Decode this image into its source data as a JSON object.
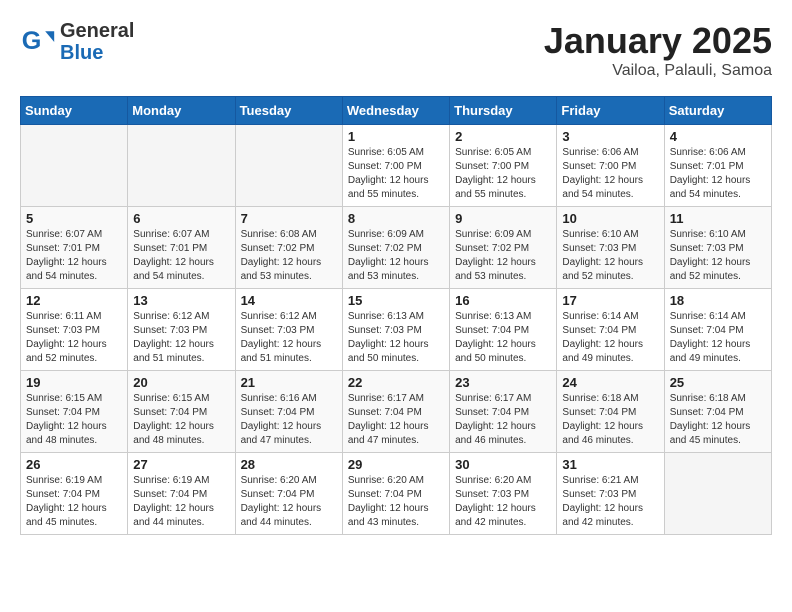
{
  "header": {
    "logo_general": "General",
    "logo_blue": "Blue",
    "month_year": "January 2025",
    "location": "Vailoa, Palauli, Samoa"
  },
  "weekdays": [
    "Sunday",
    "Monday",
    "Tuesday",
    "Wednesday",
    "Thursday",
    "Friday",
    "Saturday"
  ],
  "weeks": [
    [
      {
        "day": "",
        "info": ""
      },
      {
        "day": "",
        "info": ""
      },
      {
        "day": "",
        "info": ""
      },
      {
        "day": "1",
        "info": "Sunrise: 6:05 AM\nSunset: 7:00 PM\nDaylight: 12 hours\nand 55 minutes."
      },
      {
        "day": "2",
        "info": "Sunrise: 6:05 AM\nSunset: 7:00 PM\nDaylight: 12 hours\nand 55 minutes."
      },
      {
        "day": "3",
        "info": "Sunrise: 6:06 AM\nSunset: 7:00 PM\nDaylight: 12 hours\nand 54 minutes."
      },
      {
        "day": "4",
        "info": "Sunrise: 6:06 AM\nSunset: 7:01 PM\nDaylight: 12 hours\nand 54 minutes."
      }
    ],
    [
      {
        "day": "5",
        "info": "Sunrise: 6:07 AM\nSunset: 7:01 PM\nDaylight: 12 hours\nand 54 minutes."
      },
      {
        "day": "6",
        "info": "Sunrise: 6:07 AM\nSunset: 7:01 PM\nDaylight: 12 hours\nand 54 minutes."
      },
      {
        "day": "7",
        "info": "Sunrise: 6:08 AM\nSunset: 7:02 PM\nDaylight: 12 hours\nand 53 minutes."
      },
      {
        "day": "8",
        "info": "Sunrise: 6:09 AM\nSunset: 7:02 PM\nDaylight: 12 hours\nand 53 minutes."
      },
      {
        "day": "9",
        "info": "Sunrise: 6:09 AM\nSunset: 7:02 PM\nDaylight: 12 hours\nand 53 minutes."
      },
      {
        "day": "10",
        "info": "Sunrise: 6:10 AM\nSunset: 7:03 PM\nDaylight: 12 hours\nand 52 minutes."
      },
      {
        "day": "11",
        "info": "Sunrise: 6:10 AM\nSunset: 7:03 PM\nDaylight: 12 hours\nand 52 minutes."
      }
    ],
    [
      {
        "day": "12",
        "info": "Sunrise: 6:11 AM\nSunset: 7:03 PM\nDaylight: 12 hours\nand 52 minutes."
      },
      {
        "day": "13",
        "info": "Sunrise: 6:12 AM\nSunset: 7:03 PM\nDaylight: 12 hours\nand 51 minutes."
      },
      {
        "day": "14",
        "info": "Sunrise: 6:12 AM\nSunset: 7:03 PM\nDaylight: 12 hours\nand 51 minutes."
      },
      {
        "day": "15",
        "info": "Sunrise: 6:13 AM\nSunset: 7:03 PM\nDaylight: 12 hours\nand 50 minutes."
      },
      {
        "day": "16",
        "info": "Sunrise: 6:13 AM\nSunset: 7:04 PM\nDaylight: 12 hours\nand 50 minutes."
      },
      {
        "day": "17",
        "info": "Sunrise: 6:14 AM\nSunset: 7:04 PM\nDaylight: 12 hours\nand 49 minutes."
      },
      {
        "day": "18",
        "info": "Sunrise: 6:14 AM\nSunset: 7:04 PM\nDaylight: 12 hours\nand 49 minutes."
      }
    ],
    [
      {
        "day": "19",
        "info": "Sunrise: 6:15 AM\nSunset: 7:04 PM\nDaylight: 12 hours\nand 48 minutes."
      },
      {
        "day": "20",
        "info": "Sunrise: 6:15 AM\nSunset: 7:04 PM\nDaylight: 12 hours\nand 48 minutes."
      },
      {
        "day": "21",
        "info": "Sunrise: 6:16 AM\nSunset: 7:04 PM\nDaylight: 12 hours\nand 47 minutes."
      },
      {
        "day": "22",
        "info": "Sunrise: 6:17 AM\nSunset: 7:04 PM\nDaylight: 12 hours\nand 47 minutes."
      },
      {
        "day": "23",
        "info": "Sunrise: 6:17 AM\nSunset: 7:04 PM\nDaylight: 12 hours\nand 46 minutes."
      },
      {
        "day": "24",
        "info": "Sunrise: 6:18 AM\nSunset: 7:04 PM\nDaylight: 12 hours\nand 46 minutes."
      },
      {
        "day": "25",
        "info": "Sunrise: 6:18 AM\nSunset: 7:04 PM\nDaylight: 12 hours\nand 45 minutes."
      }
    ],
    [
      {
        "day": "26",
        "info": "Sunrise: 6:19 AM\nSunset: 7:04 PM\nDaylight: 12 hours\nand 45 minutes."
      },
      {
        "day": "27",
        "info": "Sunrise: 6:19 AM\nSunset: 7:04 PM\nDaylight: 12 hours\nand 44 minutes."
      },
      {
        "day": "28",
        "info": "Sunrise: 6:20 AM\nSunset: 7:04 PM\nDaylight: 12 hours\nand 44 minutes."
      },
      {
        "day": "29",
        "info": "Sunrise: 6:20 AM\nSunset: 7:04 PM\nDaylight: 12 hours\nand 43 minutes."
      },
      {
        "day": "30",
        "info": "Sunrise: 6:20 AM\nSunset: 7:03 PM\nDaylight: 12 hours\nand 42 minutes."
      },
      {
        "day": "31",
        "info": "Sunrise: 6:21 AM\nSunset: 7:03 PM\nDaylight: 12 hours\nand 42 minutes."
      },
      {
        "day": "",
        "info": ""
      }
    ]
  ]
}
